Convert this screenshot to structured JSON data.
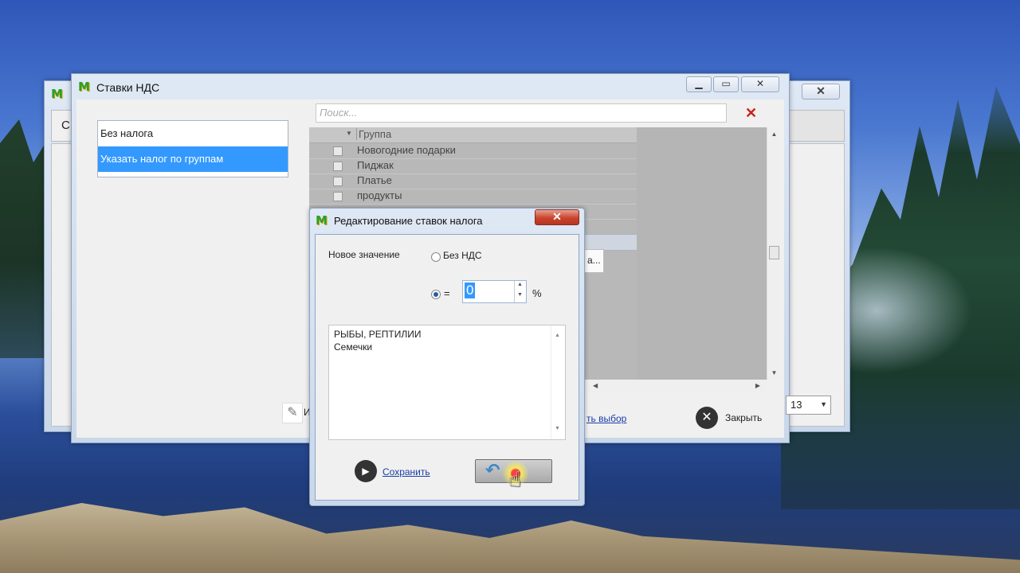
{
  "vat_window": {
    "title": "Ставки НДС",
    "tax_modes": [
      {
        "label": "Без налога",
        "selected": false
      },
      {
        "label": "Указать налог по группам",
        "selected": true
      }
    ],
    "search_placeholder": "Поиск...",
    "group_header": "Группа",
    "groups": [
      "Новогодние подарки",
      "Пиджак",
      "Платье",
      "продукты"
    ],
    "partial_button_text": "а...",
    "edit_partial": "И",
    "reset_link_partial": "ть выбор",
    "close_label": "Закрыть",
    "combo_value": "13"
  },
  "back_window": {
    "partial_title_char": "С"
  },
  "edit_dialog": {
    "title": "Редактирование ставок налога",
    "new_value_label": "Новое значение",
    "no_vat_label": "Без НДС",
    "equals_label": "=",
    "rate_value": "0",
    "percent_label": "%",
    "selected_groups": [
      "РЫБЫ, РЕПТИЛИИ",
      "Семечки"
    ],
    "save_label": "Сохранить"
  },
  "colors": {
    "selection": "#3399ff",
    "close_red": "#c8442e",
    "link": "#1a3ea8"
  }
}
